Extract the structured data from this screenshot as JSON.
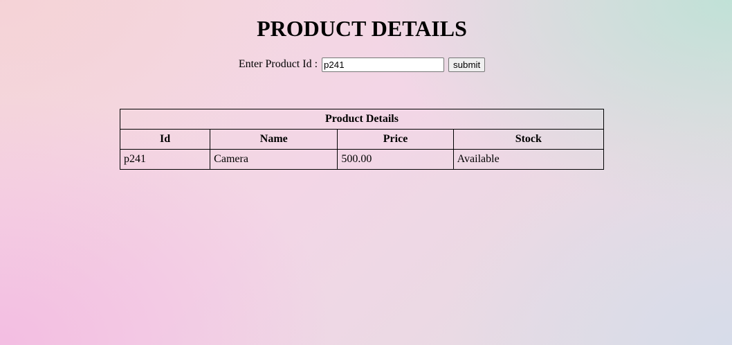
{
  "page": {
    "title": "PRODUCT DETAILS"
  },
  "search": {
    "label": "Enter Product Id :",
    "value": "p241",
    "placeholder": "",
    "submit_label": "submit"
  },
  "table": {
    "caption": "Product Details",
    "headers": [
      "Id",
      "Name",
      "Price",
      "Stock"
    ],
    "rows": [
      [
        "p241",
        "Camera",
        "500.00",
        "Available"
      ]
    ]
  }
}
